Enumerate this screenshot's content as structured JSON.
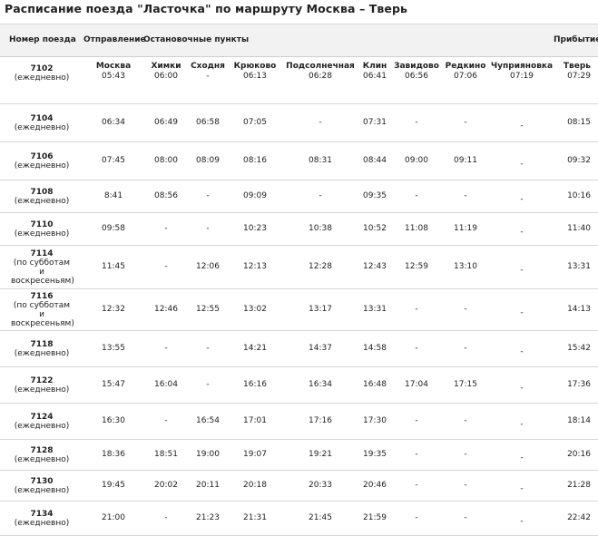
{
  "title": "Расписание поезда \"Ласточка\" по маршруту Москва – Тверь",
  "header": {
    "train_col": "Номер поезда",
    "departure_col": "Отправление",
    "stops_col": "Остановочные пункты",
    "arrival_col": "Прибытие"
  },
  "stations": [
    "Москва",
    "Химки",
    "Сходня",
    "Крюково",
    "Подсолнечная",
    "Клин",
    "Завидово",
    "Редкино",
    "Чуприяновка",
    "Тверь"
  ],
  "rows": [
    {
      "num": "7102",
      "note": "(ежедневно)",
      "times": [
        "05:43",
        "06:00",
        "-",
        "06:13",
        "06:28",
        "06:41",
        "06:56",
        "07:06",
        "07:19",
        "07:29"
      ]
    },
    {
      "num": "7104",
      "note": "(ежедневно)",
      "times": [
        "06:34",
        "06:49",
        "06:58",
        "07:05",
        "-",
        "07:31",
        "-",
        "-",
        "-",
        "08:15"
      ]
    },
    {
      "num": "7106",
      "note": "(ежедневно)",
      "times": [
        "07:45",
        "08:00",
        "08:09",
        "08:16",
        "08:31",
        "08:44",
        "09:00",
        "09:11",
        "-",
        "09:32"
      ]
    },
    {
      "num": "7108",
      "note": "(ежедневно)",
      "times": [
        "8:41",
        "08:56",
        "-",
        "09:09",
        "-",
        "09:35",
        "-",
        "-",
        "-",
        "10:16"
      ]
    },
    {
      "num": "7110",
      "note": "(ежедневно)",
      "times": [
        "09:58",
        "-",
        "-",
        "10:23",
        "10:38",
        "10:52",
        "11:08",
        "11:19",
        "-",
        "11:40"
      ]
    },
    {
      "num": "7114",
      "note": "(по субботам и воскресеньям)",
      "times": [
        "11:45",
        "-",
        "12:06",
        "12:13",
        "12:28",
        "12:43",
        "12:59",
        "13:10",
        "-",
        "13:31"
      ]
    },
    {
      "num": "7116",
      "note": "(по субботам и воскресеньям)",
      "times": [
        "12:32",
        "12:46",
        "12:55",
        "13:02",
        "13:17",
        "13:31",
        "-",
        "-",
        "-",
        "14:13"
      ]
    },
    {
      "num": "7118",
      "note": "(ежедневно)",
      "times": [
        "13:55",
        "-",
        "-",
        "14:21",
        "14:37",
        "14:58",
        "-",
        "-",
        "-",
        "15:42"
      ]
    },
    {
      "num": "7122",
      "note": "(ежедневно)",
      "times": [
        "15:47",
        "16:04",
        "-",
        "16:16",
        "16:34",
        "16:48",
        "17:04",
        "17:15",
        "-",
        "17:36"
      ]
    },
    {
      "num": "7124",
      "note": "(ежедневно)",
      "times": [
        "16:30",
        "-",
        "16:54",
        "17:01",
        "17:16",
        "17:30",
        "-",
        "-",
        "-",
        "18:14"
      ]
    },
    {
      "num": "7128",
      "note": "(ежедневно)",
      "times": [
        "18:36",
        "18:51",
        "19:00",
        "19:07",
        "19:21",
        "19:35",
        "-",
        "-",
        "-",
        "20:16"
      ]
    },
    {
      "num": "7130",
      "note": "(ежедневно)",
      "times": [
        "19:45",
        "20:02",
        "20:11",
        "20:18",
        "20:33",
        "20:46",
        "-",
        "-",
        "-",
        "21:28"
      ]
    },
    {
      "num": "7134",
      "note": "(ежедневно)",
      "times": [
        "21:00",
        "-",
        "21:23",
        "21:31",
        "21:45",
        "21:59",
        "-",
        "-",
        "-",
        "22:42"
      ]
    }
  ]
}
